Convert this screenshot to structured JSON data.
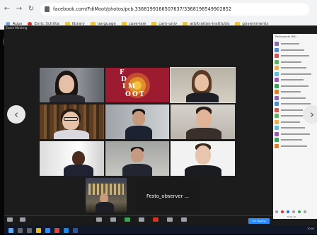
{
  "browser": {
    "url": "facebook.com/FdiMoot/photos/pcb.336819916650763​7/336819854​9902852",
    "bookmarks": [
      "Apps",
      "Enric Schitta",
      "library",
      "language",
      "case-law",
      "cam-univ",
      "arbitration-institutio",
      "governments"
    ]
  },
  "viewer": {
    "close_icon": "close-icon",
    "brand_letter": "f",
    "prev_icon": "chevron-left-icon",
    "next_icon": "chevron-right-icon"
  },
  "zoom": {
    "window_title": "Zoom Meeting",
    "tiles": [
      {
        "id": "t1",
        "kind": "person",
        "label": ""
      },
      {
        "id": "t2",
        "kind": "logo",
        "logo_text": [
          "F",
          "D",
          "I",
          "M",
          "O",
          "O",
          "T"
        ]
      },
      {
        "id": "t3",
        "kind": "person",
        "label": ""
      },
      {
        "id": "t4",
        "kind": "person",
        "label": ""
      },
      {
        "id": "t5",
        "kind": "person",
        "label": ""
      },
      {
        "id": "t6",
        "kind": "person",
        "label": ""
      },
      {
        "id": "t7",
        "kind": "person",
        "label": ""
      },
      {
        "id": "t8",
        "kind": "person",
        "label": ""
      },
      {
        "id": "t9",
        "kind": "person",
        "label": ""
      },
      {
        "id": "t10",
        "kind": "person",
        "label": ""
      },
      {
        "id": "t11",
        "kind": "text",
        "message": "Festo_observer ..."
      }
    ],
    "panel": {
      "title": "Participants (84)",
      "rows": 18,
      "footer_label": "Mute All"
    },
    "toolbar": {
      "end_label": "End Meeting"
    }
  },
  "taskbar": {
    "time": "10:04"
  }
}
